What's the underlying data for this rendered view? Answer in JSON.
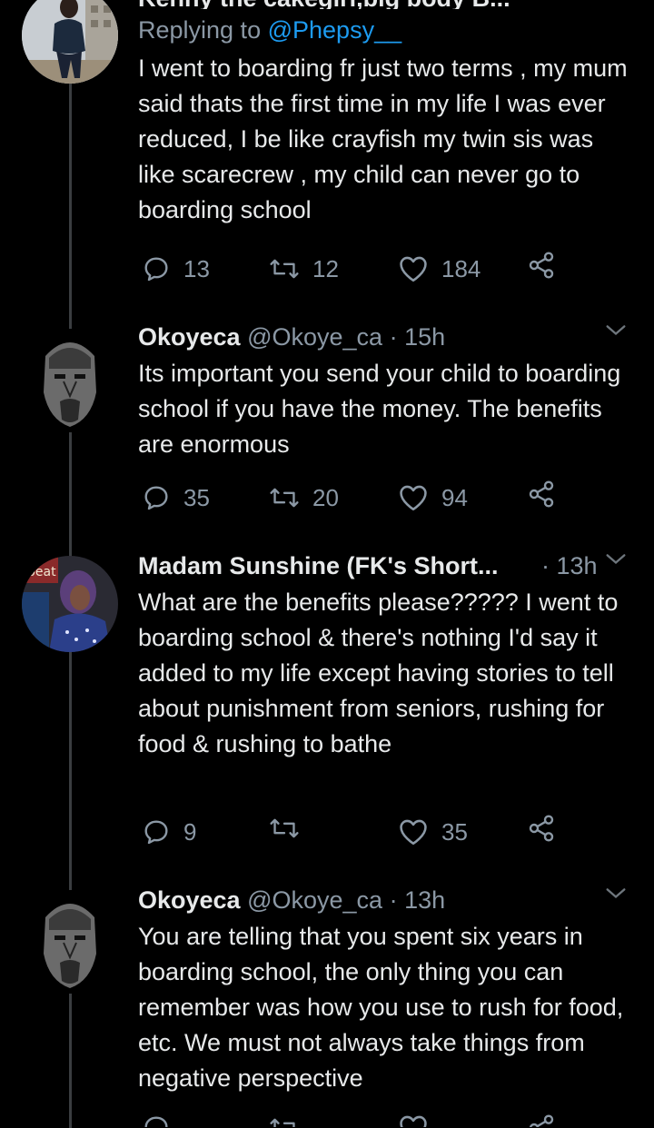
{
  "tweets": [
    {
      "id": "t1",
      "top_partial_header": "Kenny the cakegirl,big body B...",
      "replying_prefix": "Replying to",
      "replying_handle": "@Phepsy__",
      "text": "I went to boarding fr just two terms , my mum said thats the first time in my life I was ever reduced, I be like crayfish my twin sis was like scarecrew , my child can never go to boarding school",
      "replies": "13",
      "retweets": "12",
      "likes": "184"
    },
    {
      "id": "t2",
      "name": "Okoyeca",
      "handle": "@Okoye_ca",
      "time": "· 15h",
      "text": "Its important you send your child to boarding school if you have the money. The benefits are enormous",
      "replies": "35",
      "retweets": "20",
      "likes": "94"
    },
    {
      "id": "t3",
      "name": "Madam Sunshine (FK's Short...",
      "handle": "",
      "time": "· 13h",
      "text": "What are the benefits please????? I went to boarding school & there's nothing I'd say it added to my life except having stories to tell about punishment from seniors, rushing for food & rushing to bathe",
      "replies": "9",
      "retweets": "",
      "likes": "35"
    },
    {
      "id": "t4",
      "name": "Okoyeca",
      "handle": "@Okoye_ca",
      "time": "· 13h",
      "text": "You are telling that you spent six years in boarding school, the only thing you can remember was how you use to rush for food, etc. We must not always take things from negative perspective"
    }
  ],
  "colors": {
    "background": "#000000",
    "primary_text": "#e7e9ea",
    "secondary_text": "#8b98a5",
    "link": "#1d9bf0",
    "thread_line": "#3a3d40"
  },
  "icons": [
    "reply-icon",
    "retweet-icon",
    "like-icon",
    "share-icon",
    "chevron-down-icon"
  ]
}
